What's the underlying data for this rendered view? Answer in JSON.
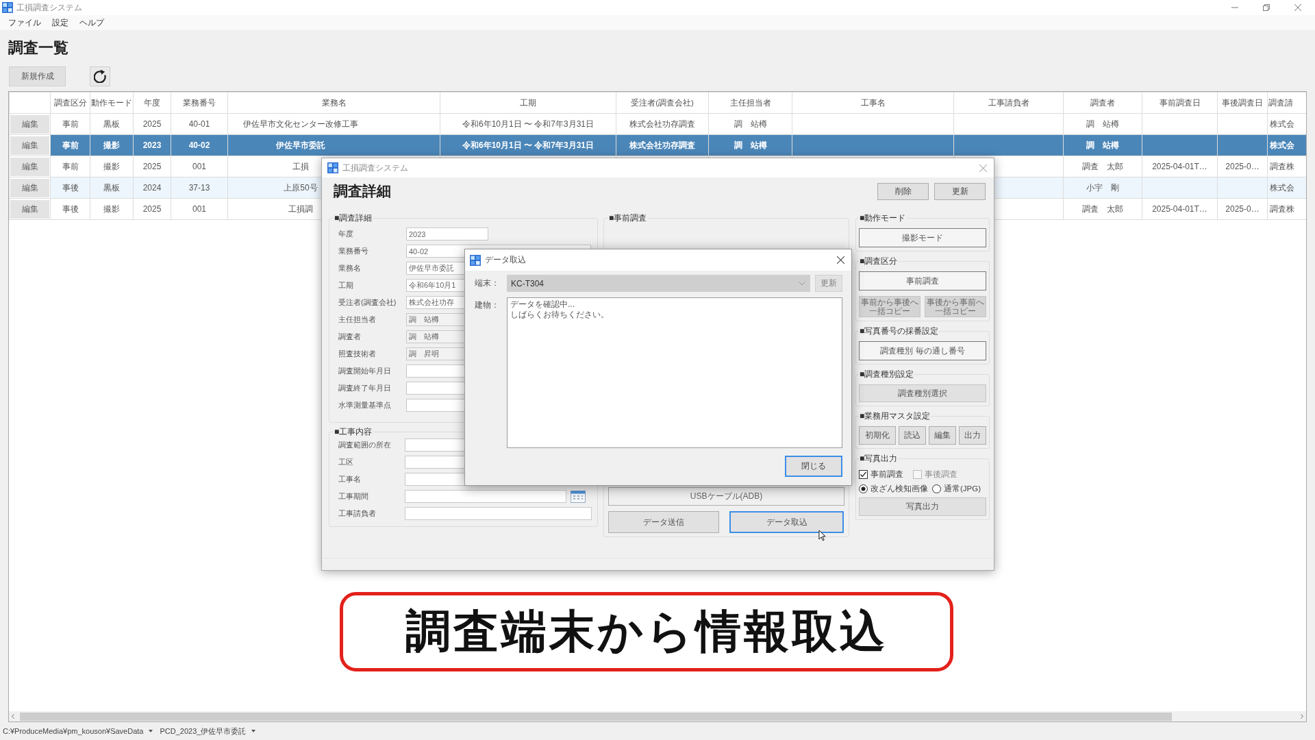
{
  "window": {
    "title": "工損調査システム"
  },
  "menu": [
    "ファイル",
    "設定",
    "ヘルプ"
  ],
  "page_title": "調査一覧",
  "toolbar": {
    "new_button": "新規作成"
  },
  "table": {
    "header": {
      "survey_type": "調査区分",
      "mode": "動作モード",
      "year": "年度",
      "job_no": "業務番号",
      "job_name": "業務名",
      "period": "工期",
      "contractor": "受注者(調査会社)",
      "lead": "主任担当者",
      "work_name": "工事名",
      "work_contractor": "工事請負者",
      "surveyor": "調査者",
      "pre_date": "事前調査日",
      "post_date": "事後調査日",
      "column_15": "調査請"
    },
    "rows": [
      {
        "selected": false,
        "edit": "編集",
        "survey_type": "事前",
        "mode": "黒板",
        "year": "2025",
        "job_no": "40-01",
        "job_name": "伊佐早市文化センター改修工事",
        "period": "令和6年10月1日 〜 令和7年3月31日",
        "contractor": "株式会社功存調査",
        "lead": "調　站樽",
        "surveyor": "調　站樽",
        "column_15": "株式会"
      },
      {
        "selected": true,
        "edit": "編集",
        "survey_type": "事前",
        "mode": "撮影",
        "year": "2023",
        "job_no": "40-02",
        "job_name": "伊佐早市委託",
        "period": "令和6年10月1日 〜 令和7年3月31日",
        "contractor": "株式会社功存調査",
        "lead": "調　站樽",
        "surveyor": "調　站樽",
        "column_15": "株式会"
      },
      {
        "selected": false,
        "edit": "編集",
        "survey_type": "事前",
        "mode": "撮影",
        "year": "2025",
        "job_no": "001",
        "job_name": "工損",
        "surveyor": "調査　太郎",
        "pre_date": "2025-04-01T…",
        "post_date": "2025-0…",
        "column_15": "調査株"
      },
      {
        "selected": false,
        "edit": "編集",
        "survey_type": "事後",
        "mode": "黒板",
        "year": "2024",
        "job_no": "37-13",
        "job_name": "上原50号",
        "surveyor": "小宇　剛",
        "column_15": "株式会"
      },
      {
        "selected": false,
        "edit": "編集",
        "survey_type": "事後",
        "mode": "撮影",
        "year": "2025",
        "job_no": "001",
        "job_name": "工損調",
        "surveyor": "調査　太郎",
        "pre_date": "2025-04-01T…",
        "post_date": "2025-0…",
        "column_15": "調査株"
      }
    ]
  },
  "detail_dialog": {
    "title": "工損調査システム",
    "heading": "調査詳細",
    "buttons": [
      "削除",
      "更新"
    ],
    "survey_group": {
      "title": "■調査詳細",
      "fields": [
        {
          "label": "年度",
          "value": "2023",
          "kind": "short"
        },
        {
          "label": "業務番号",
          "value": "40-02",
          "kind": "text"
        },
        {
          "label": "業務名",
          "value": "伊佐早市委託",
          "kind": "text"
        },
        {
          "label": "工期",
          "value": "令和6年10月1",
          "kind": "text"
        },
        {
          "label": "受注者(調査会社)",
          "value": "株式会社功存",
          "kind": "text"
        },
        {
          "label": "主任担当者",
          "value": "調　站樽",
          "kind": "select"
        },
        {
          "label": "調査者",
          "value": "調　站樽",
          "kind": "select"
        },
        {
          "label": "照査技術者",
          "value": "調　昇明",
          "kind": "select"
        },
        {
          "label": "調査開始年月日",
          "kind": "text"
        },
        {
          "label": "調査終了年月日",
          "kind": "text"
        },
        {
          "label": "水準測量基準点",
          "kind": "text"
        }
      ]
    },
    "work_group": {
      "title": "■工事内容",
      "fields": [
        {
          "label": "調査範囲の所在",
          "kind": "text"
        },
        {
          "label": "工区",
          "kind": "text"
        },
        {
          "label": "工事名",
          "kind": "text"
        },
        {
          "label": "工事期間",
          "kind": "date"
        },
        {
          "label": "工事請負者",
          "kind": "text"
        }
      ]
    },
    "pre_survey_group": {
      "title": "■事前調査",
      "connection_button": "USBケーブル(ADB)",
      "buttons": [
        {
          "label": "データ送信",
          "focused": false
        },
        {
          "label": "データ取込",
          "focused": true
        }
      ]
    },
    "mode_group": {
      "title": "■動作モード",
      "button": "撮影モード"
    },
    "type_group": {
      "title": "■調査区分",
      "button": "事前調査",
      "copy_buttons": [
        {
          "label": "事前から事後へ一括コピー",
          "disabled": true
        },
        {
          "label": "事後から事前へ一括コピー",
          "disabled": true
        }
      ]
    },
    "numbering_group": {
      "title": "■写真番号の採番設定",
      "button": "調査種別 毎の通し番号"
    },
    "kind_group": {
      "title": "■調査種別設定",
      "button": "調査種別選択"
    },
    "master_group": {
      "title": "■業務用マスタ設定",
      "buttons": [
        "初期化",
        "読込",
        "編集",
        "出力"
      ]
    },
    "photo_output_group": {
      "title": "■写真出力",
      "checkboxes": [
        {
          "label": "事前調査",
          "checked": true,
          "disabled": false
        },
        {
          "label": "事後調査",
          "checked": false,
          "disabled": true
        }
      ],
      "radios": [
        {
          "label": "改ざん検知画像",
          "selected": true
        },
        {
          "label": "通常(JPG)",
          "selected": false
        }
      ],
      "button": "写真出力"
    }
  },
  "import_dialog": {
    "title": "データ取込",
    "terminal": {
      "label": "端末：",
      "value": "KC-T304",
      "disabled": true
    },
    "refresh_button": {
      "label": "更新",
      "disabled": true
    },
    "building": {
      "label": "建物：",
      "log": "データを確認中...\nしばらくお待ちください。"
    },
    "close_button": {
      "label": "閉じる",
      "focused": true
    }
  },
  "caption": "調査端末から情報取込",
  "status_bar": {
    "path": [
      "C:¥ProduceMedia¥pm_kouson¥SaveData",
      "PCD_2023_伊佐早市委託"
    ]
  }
}
